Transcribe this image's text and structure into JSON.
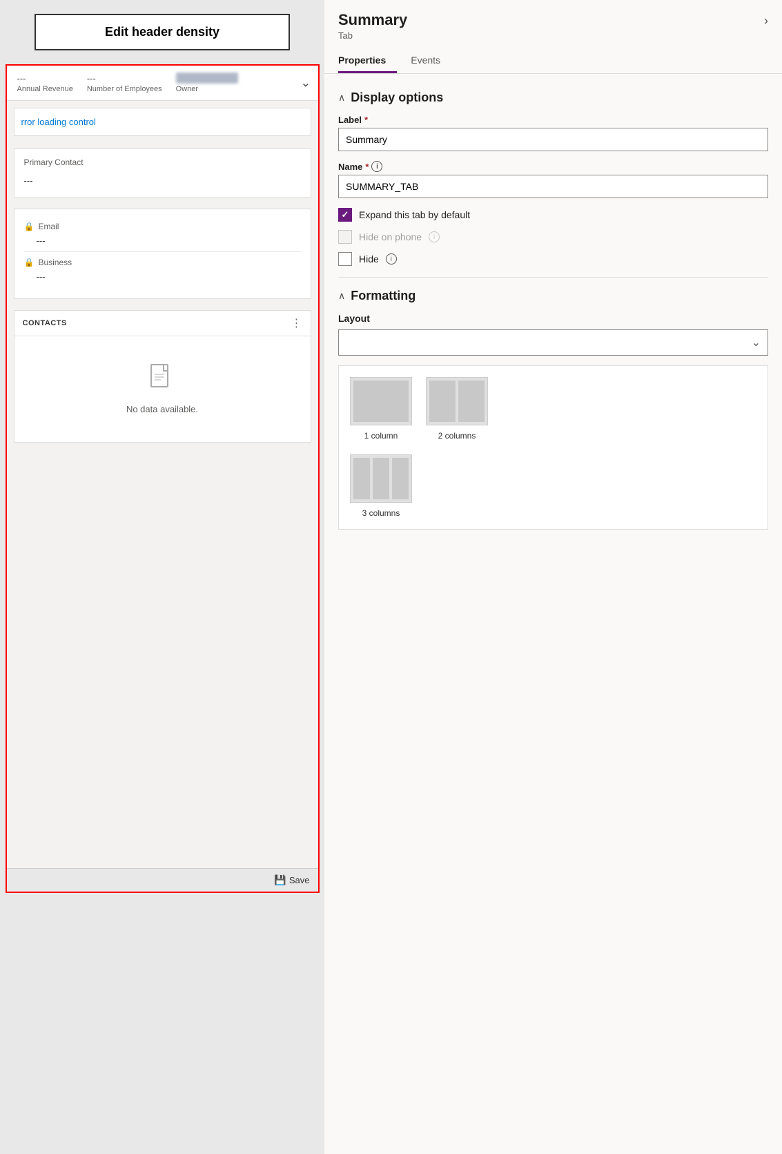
{
  "header": {
    "edit_button_label": "Edit header density"
  },
  "left_panel": {
    "fields": [
      {
        "value": "---",
        "label": "Annual Revenue"
      },
      {
        "value": "---",
        "label": "Number of Employees"
      },
      {
        "value": "",
        "label": "Owner"
      }
    ],
    "error_text": "rror loading control",
    "primary_contact_label": "Primary Contact",
    "primary_contact_value": "---",
    "email_label": "Email",
    "email_value": "---",
    "business_label": "Business",
    "business_value": "---",
    "contacts_label": "CONTACTS",
    "no_data_text": "No data available.",
    "save_label": "Save"
  },
  "right_panel": {
    "title": "Summary",
    "subtitle": "Tab",
    "tabs": [
      {
        "label": "Properties",
        "active": true
      },
      {
        "label": "Events",
        "active": false
      }
    ],
    "chevron": "›",
    "display_options": {
      "heading": "Display options",
      "label_field_label": "Label",
      "label_required": true,
      "label_value": "Summary",
      "name_field_label": "Name",
      "name_required": true,
      "name_info": "ⓘ",
      "name_value": "SUMMARY_TAB",
      "expand_label": "Expand this tab by default",
      "hide_phone_label": "Hide on phone",
      "hide_phone_info": "ⓘ",
      "hide_label": "Hide",
      "hide_info": "ⓘ"
    },
    "formatting": {
      "heading": "Formatting",
      "layout_label": "Layout",
      "options": [
        {
          "name": "1 column",
          "cols": 1
        },
        {
          "name": "2 columns",
          "cols": 2
        },
        {
          "name": "3 columns",
          "cols": 3
        }
      ]
    }
  },
  "icons": {
    "chevron_down": "∨",
    "lock": "🔒",
    "no_data": "🗋",
    "save": "💾",
    "collapse": "∧"
  }
}
